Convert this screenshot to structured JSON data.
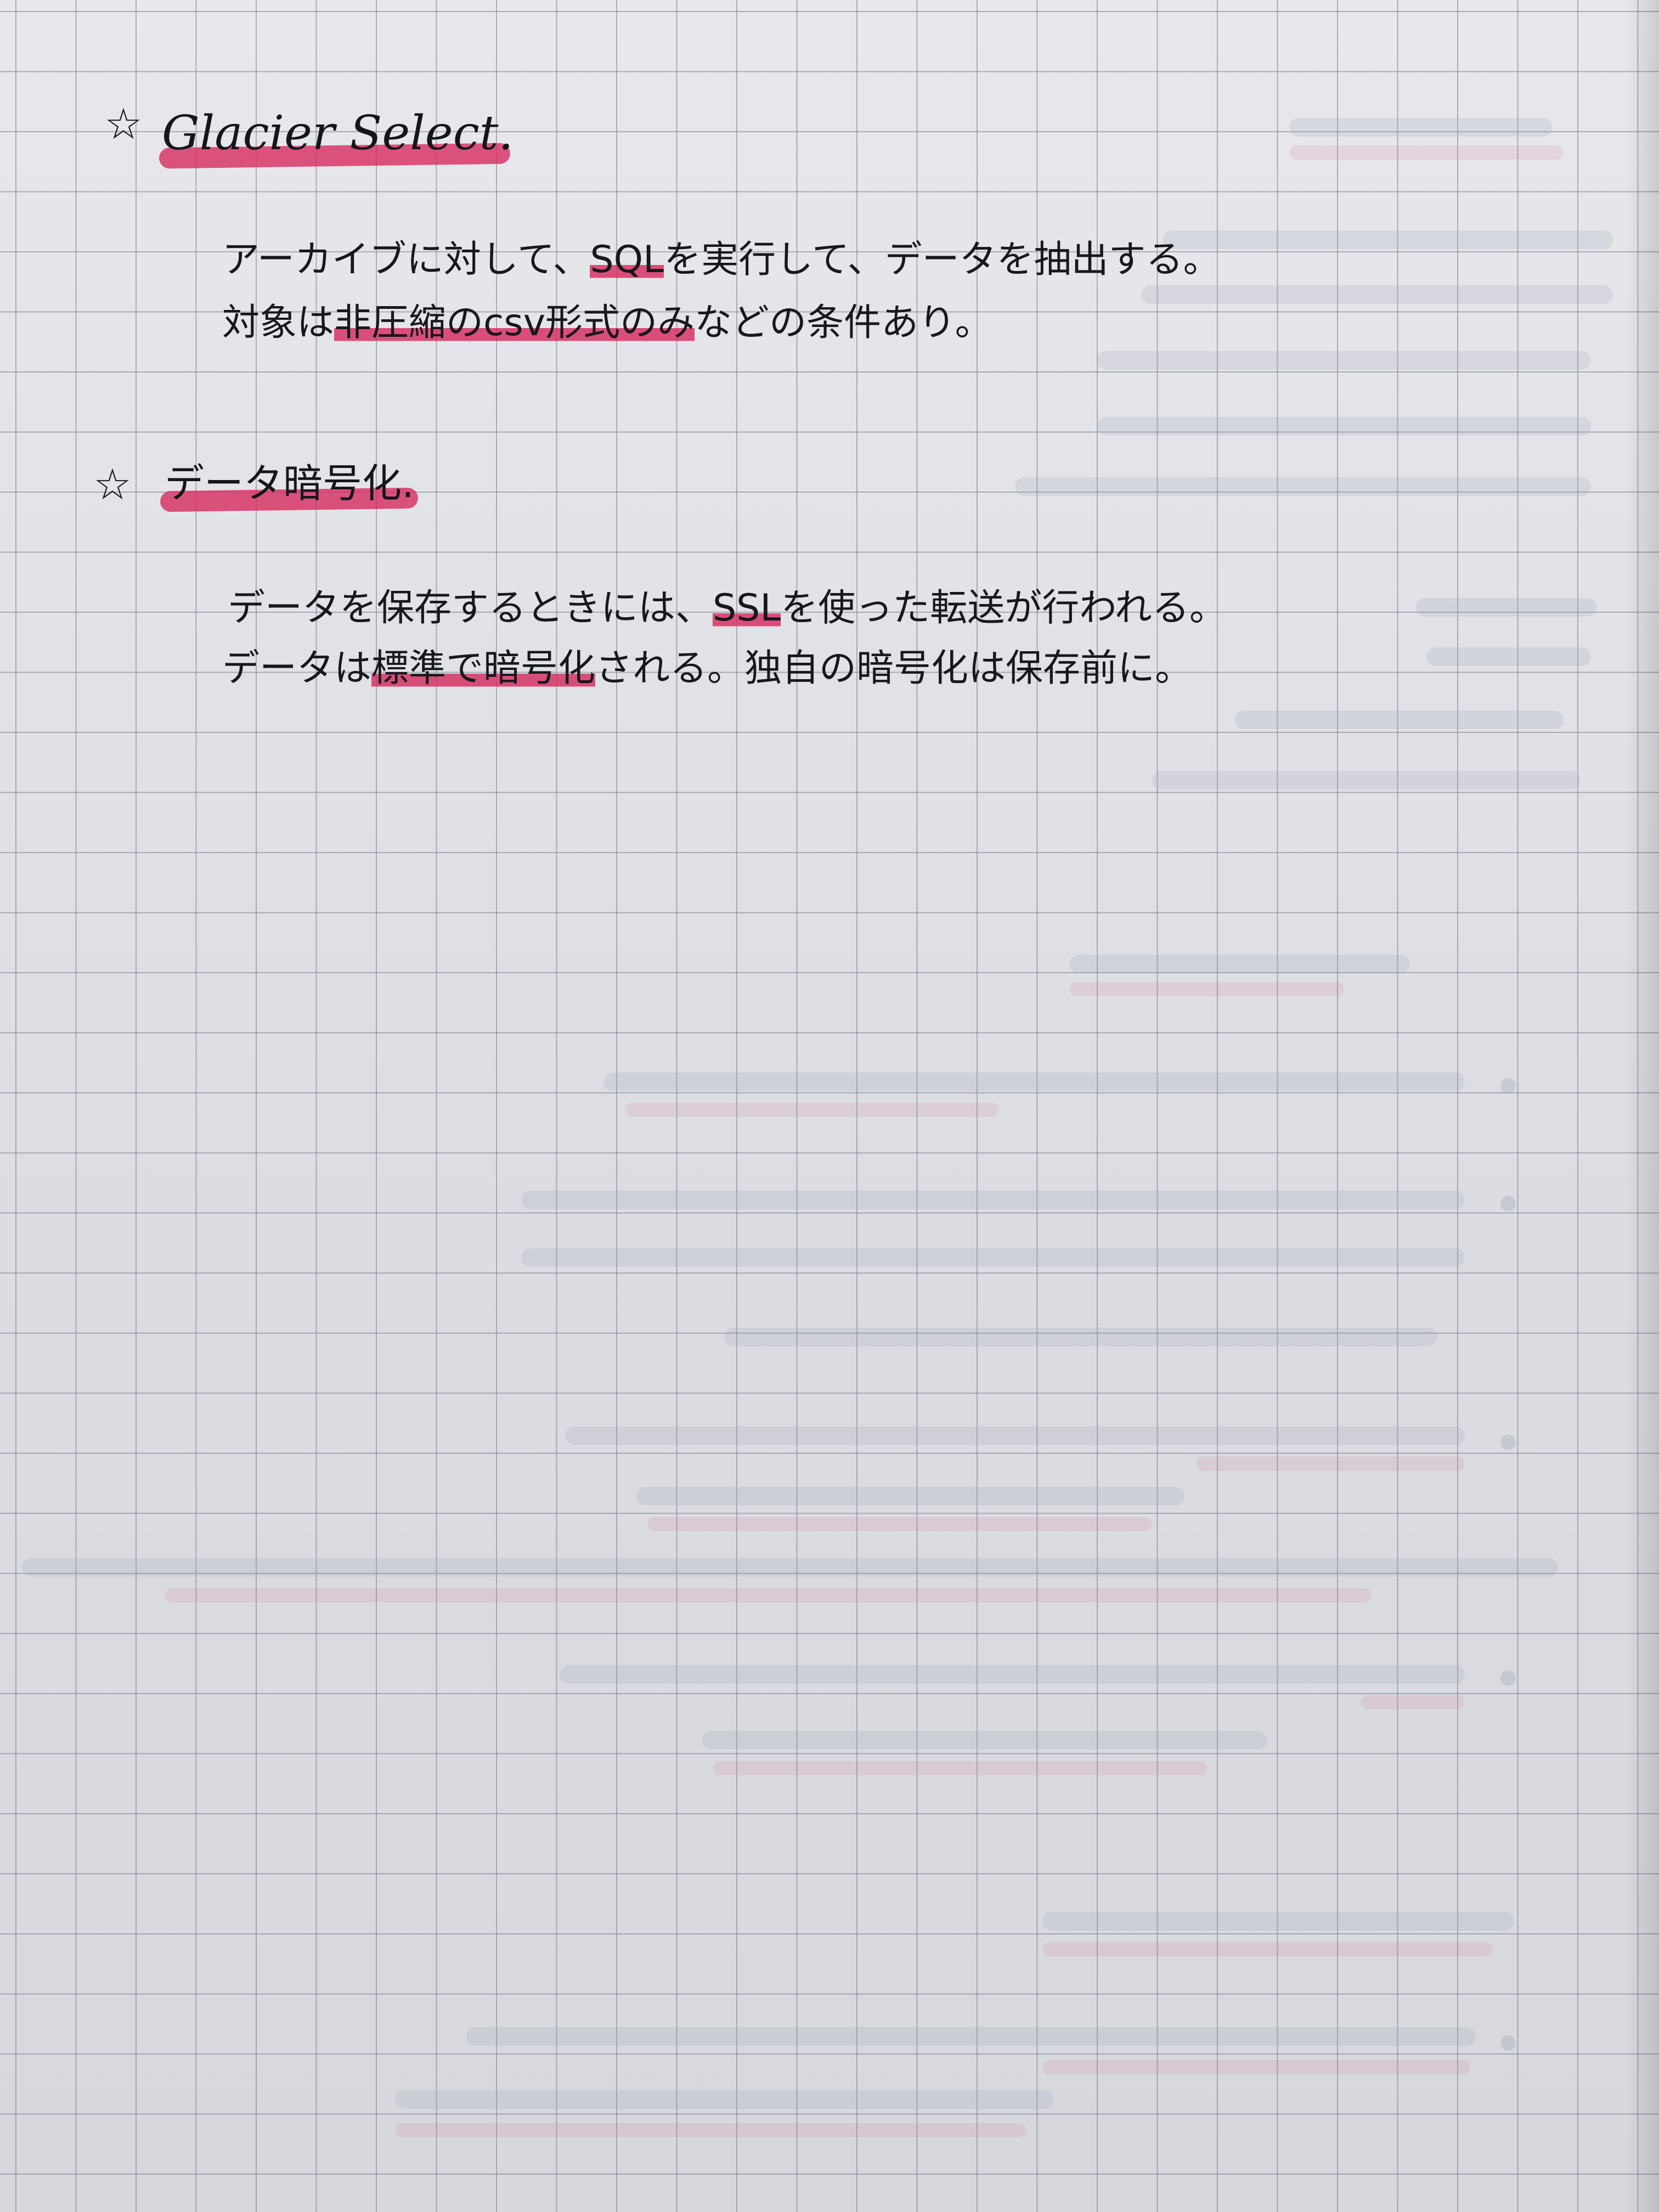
{
  "sections": [
    {
      "star": "☆",
      "heading": "Glacier Select",
      "heading_suffix": ".",
      "lines": [
        [
          {
            "t": "アーカイブに対して、"
          },
          {
            "t": "SQL",
            "hl": true
          },
          {
            "t": "を実行して、データを抽出する。"
          }
        ],
        [
          {
            "t": "対象は"
          },
          {
            "t": "非圧縮のcsv形式のみ",
            "hl": true
          },
          {
            "t": "などの条件あり。"
          }
        ]
      ]
    },
    {
      "star": "☆",
      "heading": "データ暗号化",
      "heading_suffix": ".",
      "lines": [
        [
          {
            "t": "データを保存するときには、"
          },
          {
            "t": "SSL",
            "hl": true
          },
          {
            "t": "を使った転送が行われる。"
          }
        ],
        [
          {
            "t": "データは"
          },
          {
            "t": "標準で暗号化",
            "hl": true
          },
          {
            "t": "される。独自の暗号化は保存前に。"
          }
        ]
      ]
    }
  ],
  "colors": {
    "highlight": "#d6285c",
    "ink": "#17171d",
    "paper": "#dfe0e5",
    "grid": "#787c8a"
  }
}
